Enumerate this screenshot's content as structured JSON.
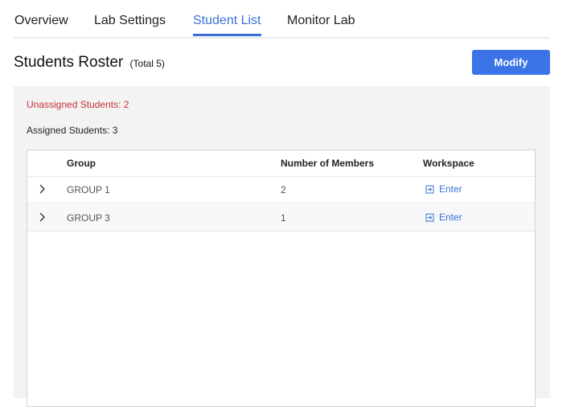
{
  "tabs": [
    {
      "label": "Overview",
      "active": false
    },
    {
      "label": "Lab Settings",
      "active": false
    },
    {
      "label": "Student List",
      "active": true
    },
    {
      "label": "Monitor Lab",
      "active": false
    }
  ],
  "roster": {
    "title": "Students Roster",
    "total": "(Total 5)",
    "modify_label": "Modify"
  },
  "summary": {
    "unassigned": "Unassigned Students: 2",
    "assigned": "Assigned Students: 3"
  },
  "table": {
    "columns": [
      "Group",
      "Number of Members",
      "Workspace"
    ],
    "rows": [
      {
        "group": "GROUP 1",
        "members": "2",
        "workspace": "Enter"
      },
      {
        "group": "GROUP 3",
        "members": "1",
        "workspace": "Enter"
      }
    ]
  },
  "colors": {
    "accent": "#3b6fd6",
    "button": "#3a74e6",
    "warning": "#c8323a",
    "panel_bg": "#f3f3f3"
  },
  "icons": {
    "expand": "chevron-right-icon",
    "enter": "enter-workspace-icon"
  }
}
